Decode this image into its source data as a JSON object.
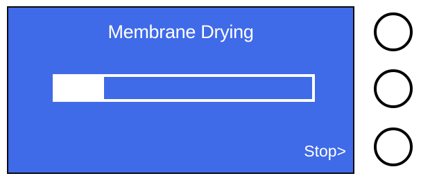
{
  "screen": {
    "title": "Membrane Drying",
    "background_color": "#3f6ae8",
    "progress": {
      "fraction": 0.19
    },
    "softkey_label": "Stop>"
  },
  "hardware_buttons": [
    {
      "name": "top-softkey"
    },
    {
      "name": "middle-softkey"
    },
    {
      "name": "bottom-softkey"
    }
  ]
}
